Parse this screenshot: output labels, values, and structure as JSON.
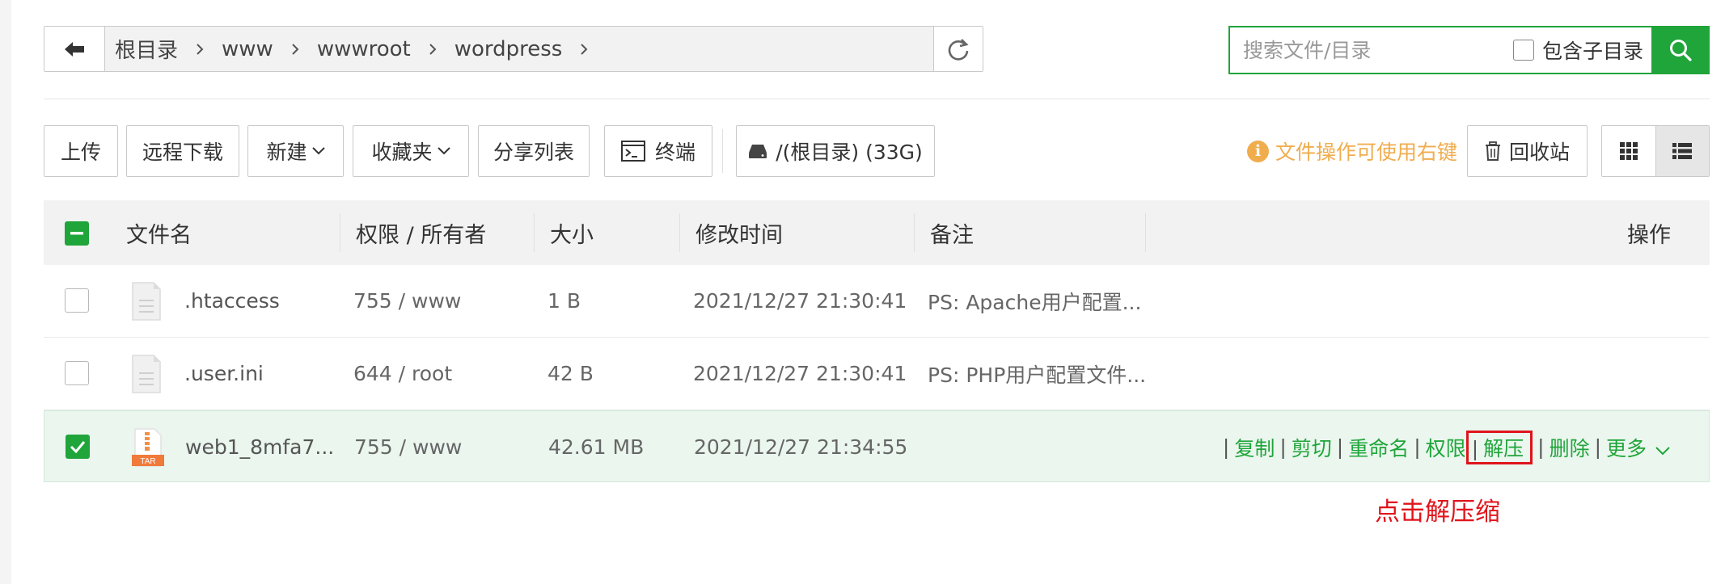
{
  "breadcrumb": [
    "根目录",
    "www",
    "wwwroot",
    "wordpress"
  ],
  "search": {
    "placeholder": "搜索文件/目录",
    "include_subdir_label": "包含子目录"
  },
  "toolbar": {
    "upload": "上传",
    "remote_download": "远程下载",
    "new": "新建",
    "favorites": "收藏夹",
    "share_list": "分享列表",
    "terminal": "终端",
    "disk": "/(根目录) (33G)",
    "hint": "文件操作可使用右键",
    "recycle_bin": "回收站"
  },
  "table": {
    "headers": {
      "name": "文件名",
      "perm": "权限 / 所有者",
      "size": "大小",
      "mtime": "修改时间",
      "note": "备注",
      "ops": "操作"
    },
    "rows": [
      {
        "name": ".htaccess",
        "perm": "755 / www",
        "size": "1 B",
        "mtime": "2021/12/27 21:30:41",
        "note": "PS: Apache用户配置...",
        "selected": false,
        "icon": "file-icon"
      },
      {
        "name": ".user.ini",
        "perm": "644 / root",
        "size": "42 B",
        "mtime": "2021/12/27 21:30:41",
        "note": "PS: PHP用户配置文件...",
        "selected": false,
        "icon": "file-icon"
      },
      {
        "name": "web1_8mfa7...",
        "perm": "755 / www",
        "size": "42.61 MB",
        "mtime": "2021/12/27 21:34:55",
        "note": "",
        "selected": true,
        "icon": "tar-icon",
        "tar_badge": "TAR"
      }
    ],
    "ops": {
      "copy": "复制",
      "cut": "剪切",
      "rename": "重命名",
      "permission": "权限",
      "extract": "解压",
      "delete": "删除",
      "more": "更多"
    }
  },
  "annotation": "点击解压缩",
  "colors": {
    "accent": "#20a53a",
    "warning": "#f0ad4e",
    "highlight": "#e0141b"
  }
}
